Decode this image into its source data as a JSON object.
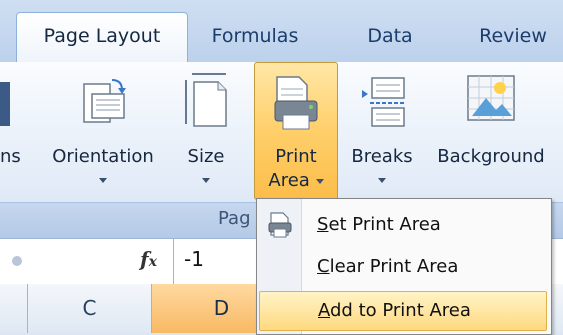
{
  "tabs": [
    "Page Layout",
    "Formulas",
    "Data",
    "Review"
  ],
  "active_tab": "Page Layout",
  "ribbon": {
    "buttons": {
      "margins": "ns",
      "orientation": "Orientation",
      "size": "Size",
      "print_area_line1": "Print",
      "print_area_line2": "Area",
      "breaks": "Breaks",
      "background": "Background"
    },
    "group_label": "Pag"
  },
  "formula_bar": {
    "fx": "fx",
    "value": "-1"
  },
  "columns": [
    "C",
    "D"
  ],
  "selected_column": "D",
  "print_area_menu": {
    "items": [
      {
        "mnemonic": "S",
        "rest": "et Print Area"
      },
      {
        "mnemonic": "C",
        "rest": "lear Print Area"
      },
      {
        "mnemonic": "A",
        "rest": "dd to Print Area"
      }
    ],
    "hovered_index": 2
  },
  "colors": {
    "ribbon_bg": "#eaf1fa",
    "pressed_button": "#ffcf6a",
    "menu_hover": "#ffd980",
    "selected_column": "#f8b964"
  },
  "icons": [
    "orientation-icon",
    "size-icon",
    "print-area-icon",
    "breaks-icon",
    "background-icon",
    "set-print-area-icon"
  ]
}
